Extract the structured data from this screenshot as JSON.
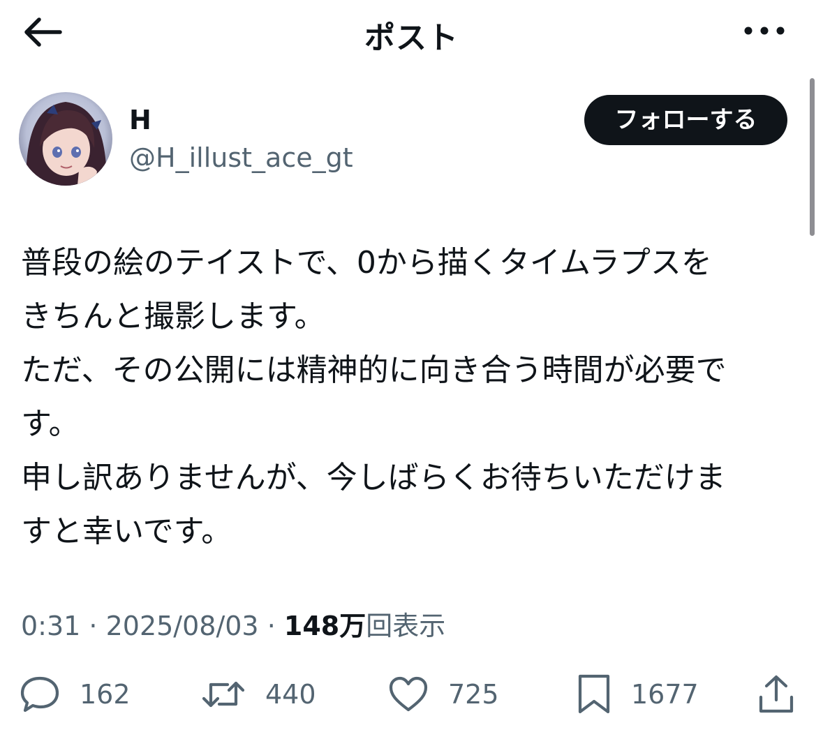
{
  "header": {
    "title": "ポスト",
    "back_icon": "arrow-left-icon",
    "more_icon": "more-horizontal-icon"
  },
  "author": {
    "display_name": "H",
    "handle": "@H_illust_ace_gt",
    "follow_label": "フォローする"
  },
  "tweet": {
    "text": "普段の絵のテイストで、0から描くタイムラプスを\nきちんと撮影します。\nただ、その公開には精神的に向き合う時間が必要で\nす。\n申し訳ありませんが、今しばらくお待ちいただけま\nすと幸いです。"
  },
  "meta": {
    "time": "0:31",
    "separator": " · ",
    "date": "2025/08/03",
    "views_count": "148万",
    "views_label": "回表示"
  },
  "actions": {
    "reply": {
      "icon": "reply-icon",
      "count": "162"
    },
    "repost": {
      "icon": "repost-icon",
      "count": "440"
    },
    "like": {
      "icon": "heart-icon",
      "count": "725"
    },
    "bookmark": {
      "icon": "bookmark-icon",
      "count": "1677"
    },
    "share": {
      "icon": "share-icon"
    }
  }
}
